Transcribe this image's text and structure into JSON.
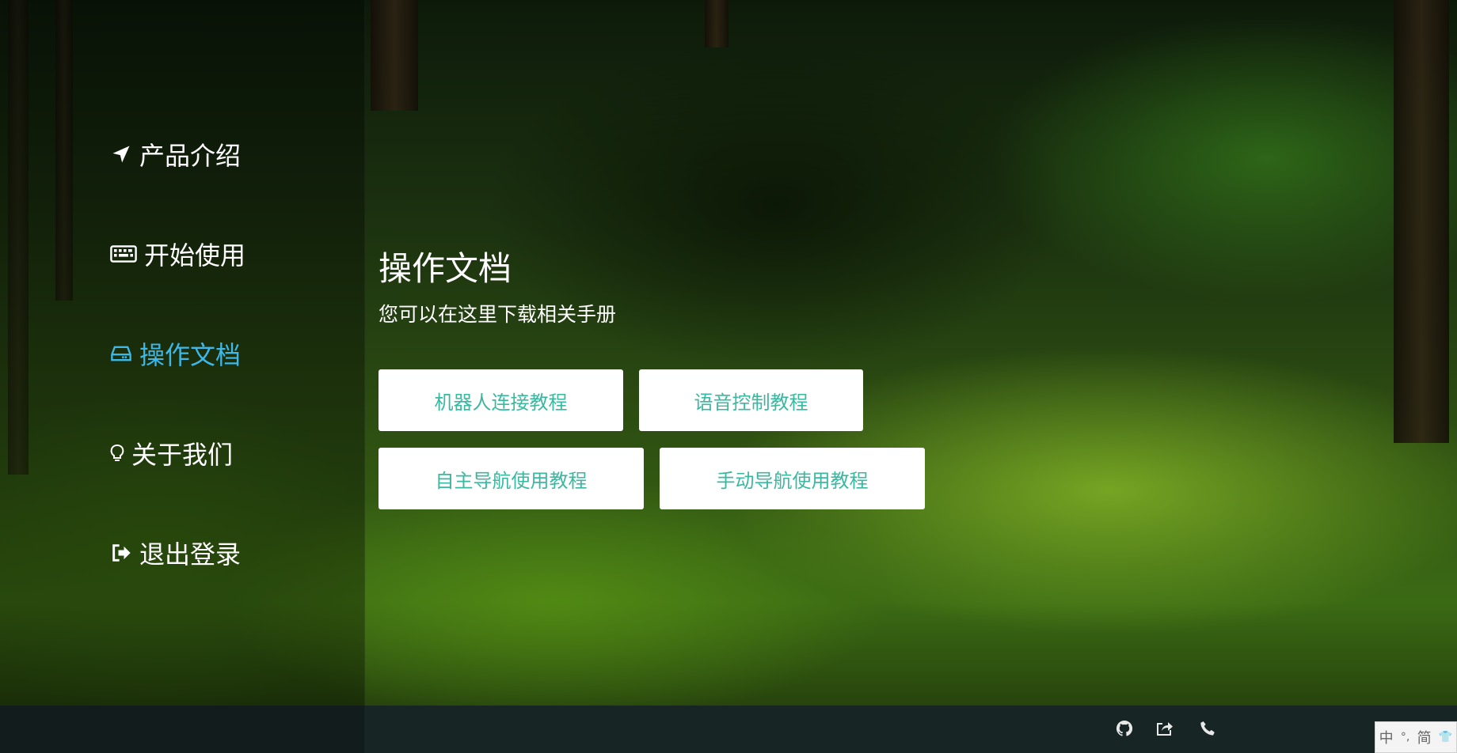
{
  "sidebar": {
    "items": [
      {
        "label": "产品介绍",
        "icon": "location-arrow-icon",
        "active": false
      },
      {
        "label": "开始使用",
        "icon": "keyboard-icon",
        "active": false
      },
      {
        "label": "操作文档",
        "icon": "hdd-icon",
        "active": true
      },
      {
        "label": "关于我们",
        "icon": "lightbulb-icon",
        "active": false
      },
      {
        "label": "退出登录",
        "icon": "sign-out-icon",
        "active": false
      }
    ]
  },
  "main": {
    "title": "操作文档",
    "subtitle": "您可以在这里下载相关手册",
    "buttons": [
      "机器人连接教程",
      "语音控制教程",
      "自主导航使用教程",
      "手动导航使用教程"
    ]
  },
  "footer": {
    "icons": [
      "github-icon",
      "share-icon",
      "phone-icon"
    ]
  },
  "ime": {
    "chars": [
      "中",
      "°,",
      "简",
      "👕"
    ]
  },
  "colors": {
    "active": "#3db8e8",
    "button_text": "#3ab8a0",
    "footer_bg": "#182525"
  }
}
